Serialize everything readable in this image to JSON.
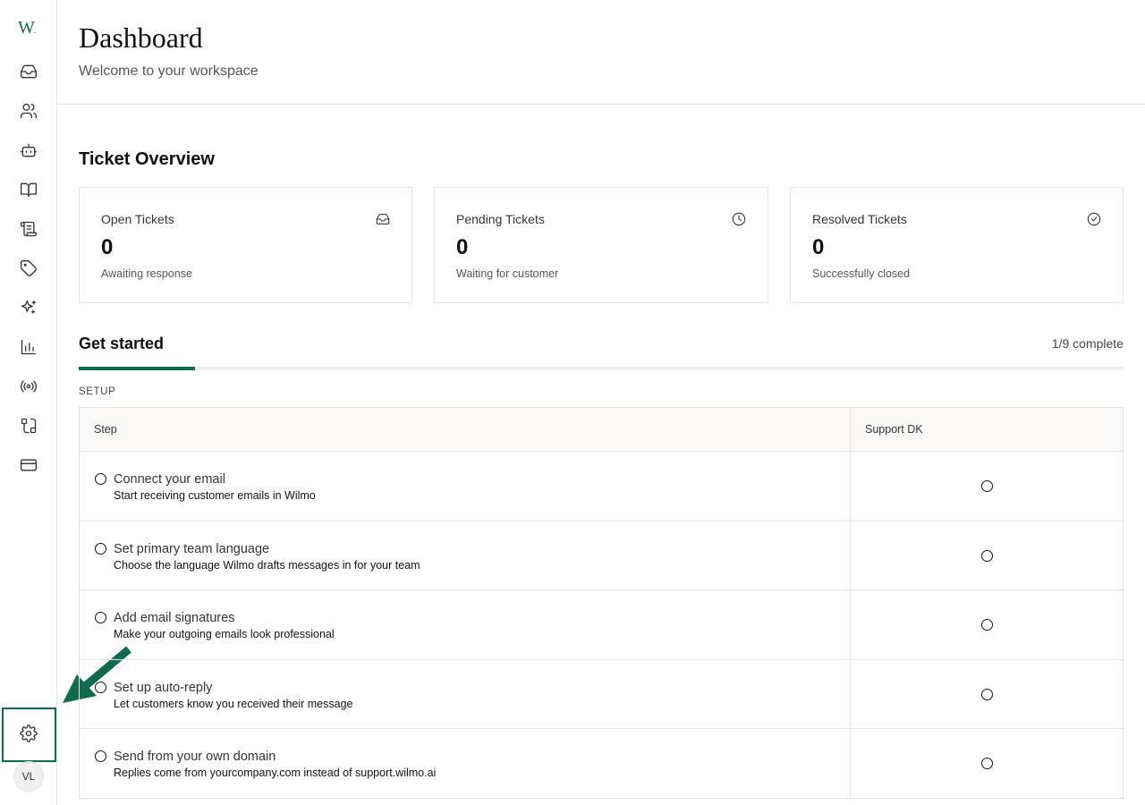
{
  "sidebar": {
    "logo": "W",
    "logo_dot": ".",
    "nav": [
      {
        "icon": "inbox-icon"
      },
      {
        "icon": "users-icon"
      },
      {
        "icon": "bot-icon"
      },
      {
        "icon": "book-open-icon"
      },
      {
        "icon": "scroll-icon"
      },
      {
        "icon": "tag-icon"
      },
      {
        "icon": "sparkles-icon"
      },
      {
        "icon": "bar-chart-icon"
      },
      {
        "icon": "broadcast-icon"
      },
      {
        "icon": "workflow-icon"
      },
      {
        "icon": "credit-card-icon"
      }
    ],
    "settings_icon": "gear-icon",
    "avatar_initials": "VL",
    "highlight_color": "#0e6b4d"
  },
  "header": {
    "title": "Dashboard",
    "subtitle": "Welcome to your workspace"
  },
  "ticket_overview": {
    "title": "Ticket Overview",
    "cards": [
      {
        "label": "Open Tickets",
        "value": "0",
        "description": "Awaiting response",
        "icon": "inbox-icon"
      },
      {
        "label": "Pending Tickets",
        "value": "0",
        "description": "Waiting for customer",
        "icon": "clock-icon"
      },
      {
        "label": "Resolved Tickets",
        "value": "0",
        "description": "Successfully closed",
        "icon": "check-circle-icon"
      }
    ]
  },
  "get_started": {
    "title": "Get started",
    "progress_text": "1/9 complete",
    "progress_fraction": 0.111,
    "section_label": "SETUP",
    "columns": [
      "Step",
      "Support DK"
    ],
    "steps": [
      {
        "title": "Connect your email",
        "description": "Start receiving customer emails in Wilmo"
      },
      {
        "title": "Set primary team language",
        "description": "Choose the language Wilmo drafts messages in for your team"
      },
      {
        "title": "Add email signatures",
        "description": "Make your outgoing emails look professional"
      },
      {
        "title": "Set up auto-reply",
        "description": "Let customers know you received their message"
      },
      {
        "title": "Send from your own domain",
        "description": "Replies come from yourcompany.com instead of support.wilmo.ai"
      }
    ]
  },
  "colors": {
    "accent": "#0e6b4d",
    "border": "#e3e3e3"
  }
}
